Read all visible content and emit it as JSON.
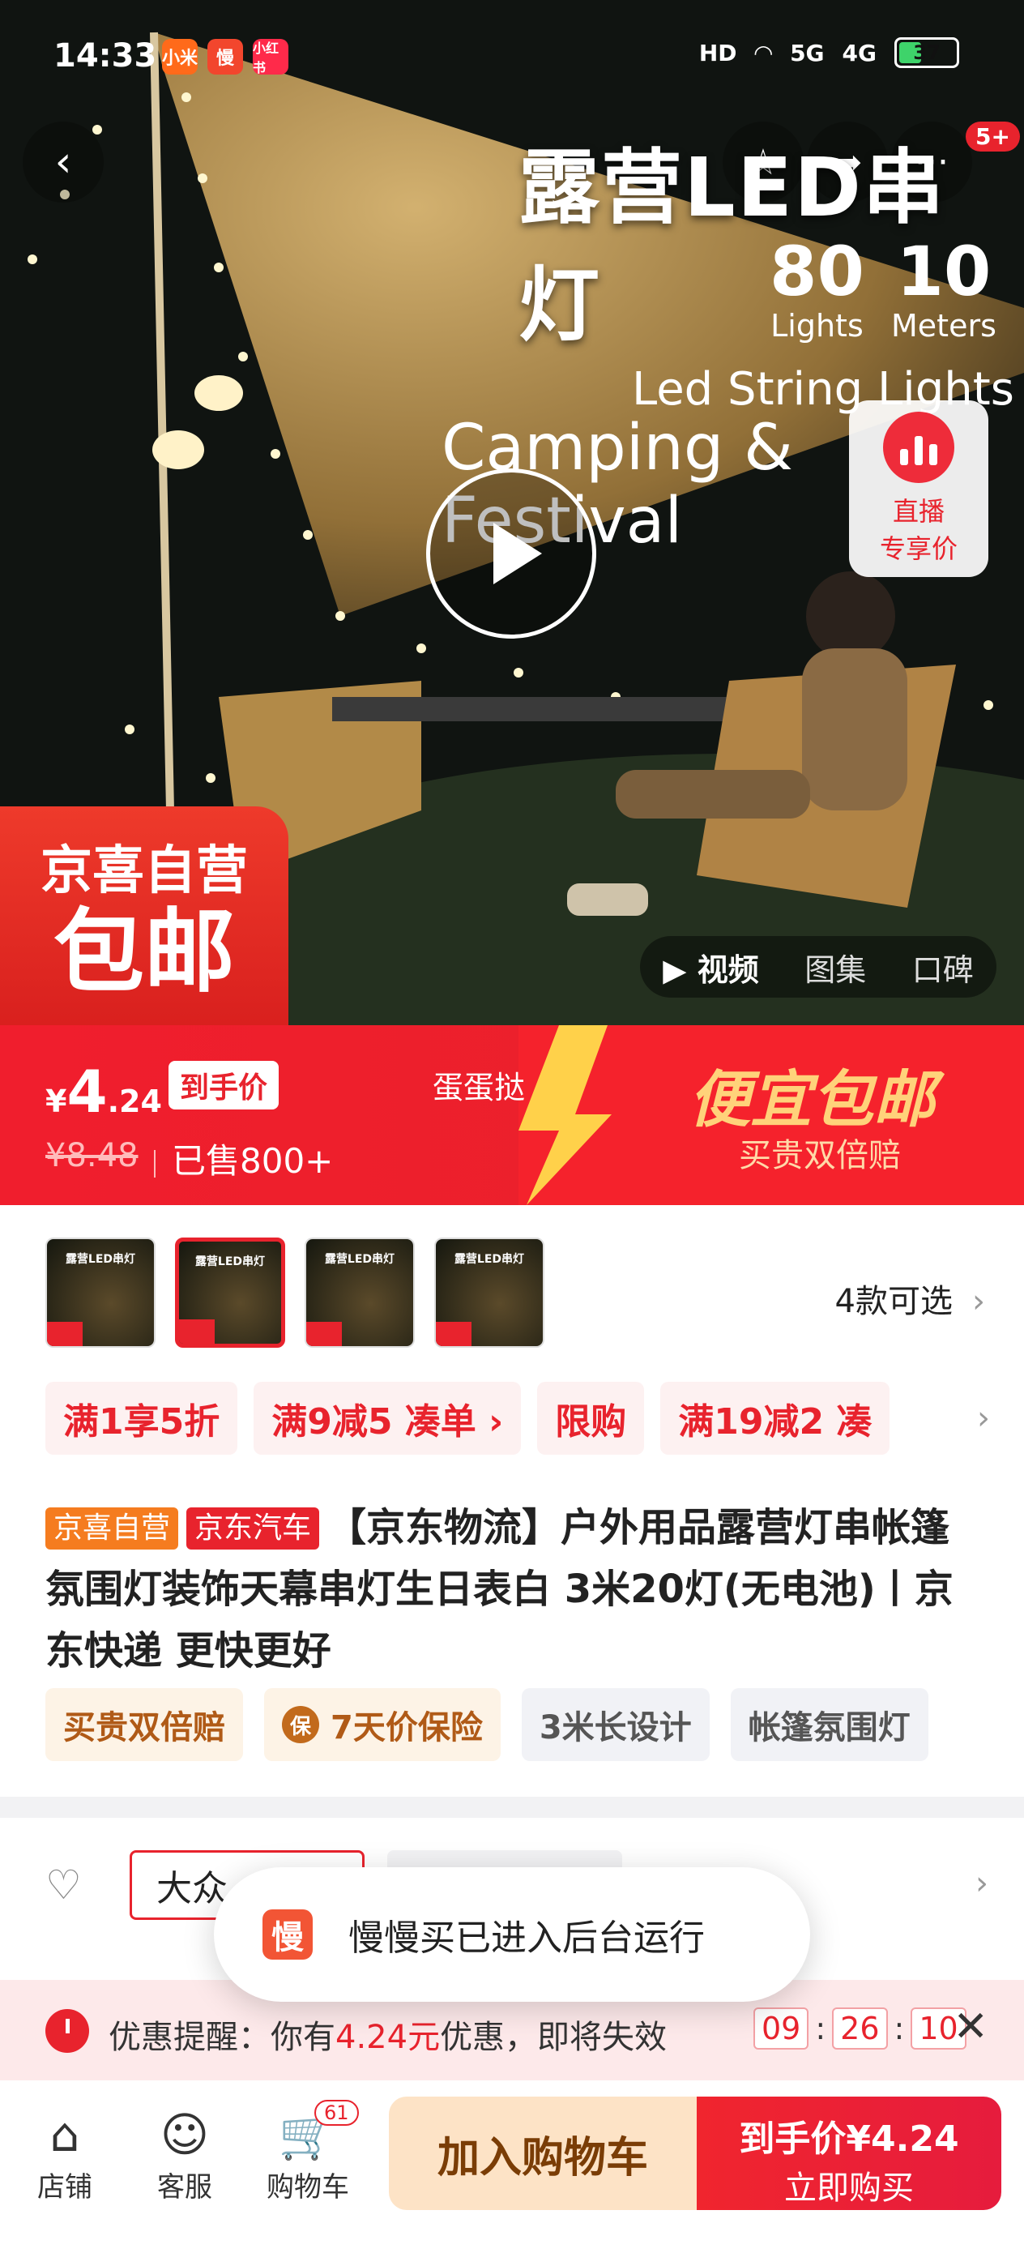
{
  "status": {
    "time": "14:33",
    "apps": [
      "小米",
      "慢",
      "小红书"
    ],
    "hd": "HD",
    "net1": "5G",
    "net2": "4G",
    "battery": "37"
  },
  "header": {
    "back_icon": "chevron-left-icon",
    "badge": "5+"
  },
  "hero": {
    "title": "露营LED串灯",
    "stats": [
      {
        "num": "80",
        "unit": "Lights"
      },
      {
        "num": "10",
        "unit": "Meters"
      }
    ],
    "sub1": "Led String Lights",
    "sub2": "Camping & Festival",
    "live_line1": "直播",
    "live_line2": "专享价",
    "promo_line1": "京喜自营",
    "promo_line2": "包邮",
    "media_tabs": [
      "▶ 视频",
      "图集",
      "口碑"
    ]
  },
  "price": {
    "currency": "¥",
    "integer": "4",
    "decimal": ".24",
    "tag": "到手价",
    "original": "¥8.48",
    "sold": "已售800+",
    "shop": "蛋蛋挞",
    "slogan": "便宜包邮",
    "slogan_sub": "买贵双倍赔"
  },
  "product": {
    "thumb_text": "露营LED串灯",
    "variants": "4款可选",
    "coupons": [
      "满1享5折",
      "满9减5 凑单 ›",
      "限购",
      "满19减2 凑"
    ],
    "tag1": "京喜自营",
    "tag2": "京东汽车",
    "title": "【京东物流】户外用品露营灯串帐篷氛围灯装饰天幕串灯生日表白 3米20灯(无电池)丨京东快递 更快更好",
    "features": [
      "买贵双倍赔",
      "7天价保险",
      "3米长设计",
      "帐篷氛围灯"
    ],
    "shield_char": "保"
  },
  "section2": {
    "button": "大众",
    "toast_icon": "慢",
    "toast": "慢慢买已进入后台运行"
  },
  "reminder": {
    "prefix": "优惠提醒：你有",
    "amount": "4.24元",
    "suffix": "优惠，即将失效",
    "h": "09",
    "m": "26",
    "s": "10"
  },
  "bottom": {
    "shop": "店铺",
    "service": "客服",
    "cart": "购物车",
    "cart_count": "61",
    "add_cart": "加入购物车",
    "buy_price": "到手价¥4.24",
    "buy_now": "立即购买"
  }
}
